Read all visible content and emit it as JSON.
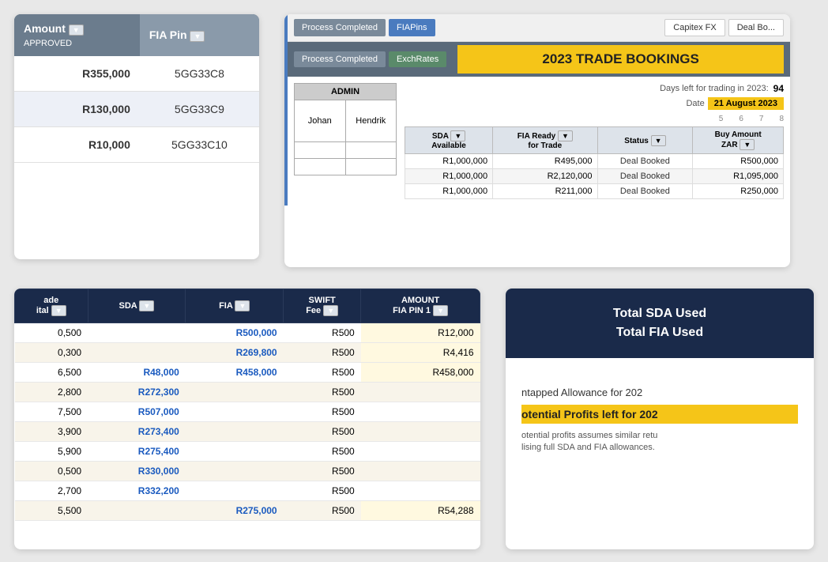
{
  "topLeft": {
    "col1_header": "Amount",
    "col1_sub": "APPROVED",
    "col2_header": "FIA Pin",
    "rows": [
      {
        "amount": "R355,000",
        "fia": "5GG33C8"
      },
      {
        "amount": "R130,000",
        "fia": "5GG33C9"
      },
      {
        "amount": "R10,000",
        "fia": "5GG33C10"
      }
    ]
  },
  "topRight": {
    "btn_process1": "Process Completed",
    "btn_fiapins": "FIAPins",
    "btn_process2": "Process Completed",
    "btn_exchrates": "ExchRates",
    "btn_capitex": "Capitex FX",
    "btn_dealbo": "Deal Bo...",
    "title": "2023 TRADE BOOKINGS",
    "days_label": "Days left for trading in 2023:",
    "days_value": "94",
    "date_label": "Date",
    "date_value": "21 August 2023",
    "col_nums": [
      "5",
      "6",
      "7",
      "8"
    ],
    "admin_header": "ADMIN",
    "names": [
      "Johan",
      "Hendrik"
    ],
    "table_headers": [
      "SDA Available",
      "FIA Ready for Trade",
      "Status",
      "Buy Amount ZAR"
    ],
    "table_rows": [
      {
        "sda": "R1,000,000",
        "fia": "R495,000",
        "status": "Deal Booked",
        "buy": "R500,000"
      },
      {
        "sda": "R1,000,000",
        "fia": "R2,120,000",
        "status": "Deal Booked",
        "buy": "R1,095,000"
      },
      {
        "sda": "R1,000,000",
        "fia": "R211,000",
        "status": "Deal Booked",
        "buy": "R250,000"
      }
    ]
  },
  "bottomLeft": {
    "headers": [
      "ade ital",
      "SDA",
      "FIA",
      "SWIFT Fee",
      "AMOUNT FIA PIN 1"
    ],
    "rows": [
      {
        "ade": "0,500",
        "sda": "",
        "fia": "R500,000",
        "swift": "R500",
        "amount": "R12,000"
      },
      {
        "ade": "0,300",
        "sda": "",
        "fia": "R269,800",
        "swift": "R500",
        "amount": "R4,416"
      },
      {
        "ade": "6,500",
        "sda": "R48,000",
        "fia": "R458,000",
        "swift": "R500",
        "amount": "R458,000"
      },
      {
        "ade": "2,800",
        "sda": "R272,300",
        "fia": "",
        "swift": "R500",
        "amount": ""
      },
      {
        "ade": "7,500",
        "sda": "R507,000",
        "fia": "",
        "swift": "R500",
        "amount": ""
      },
      {
        "ade": "3,900",
        "sda": "R273,400",
        "fia": "",
        "swift": "R500",
        "amount": ""
      },
      {
        "ade": "5,900",
        "sda": "R275,400",
        "fia": "",
        "swift": "R500",
        "amount": ""
      },
      {
        "ade": "0,500",
        "sda": "R330,000",
        "fia": "",
        "swift": "R500",
        "amount": ""
      },
      {
        "ade": "2,700",
        "sda": "R332,200",
        "fia": "",
        "swift": "R500",
        "amount": ""
      },
      {
        "ade": "5,500",
        "sda": "",
        "fia": "R275,000",
        "swift": "R500",
        "amount": "R54,288"
      }
    ]
  },
  "bottomRight": {
    "header_line1": "Total SDA Used",
    "header_line2": "Total FIA Used",
    "allowance_label": "ntapped Allowance for 202",
    "profits_label": "otential Profits left for 202",
    "note_line1": "otential profits assumes similar retu",
    "note_line2": "lising full SDA and FIA allowances."
  }
}
